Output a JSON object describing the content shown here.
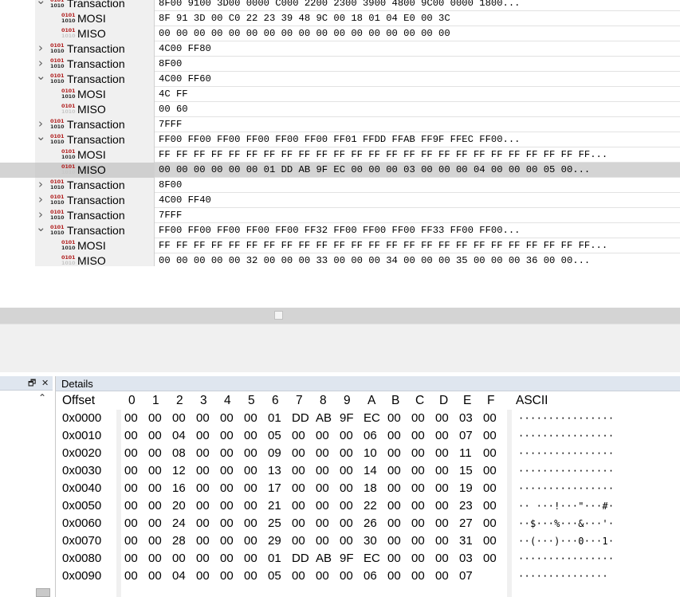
{
  "tree": {
    "rows": [
      {
        "label": "Transaction",
        "value": "8F00 9100 3D00 0000 C000 2200 2300 3900 4800 9C00 0000 1800...",
        "kind": "transaction",
        "expanded": true
      },
      {
        "label": "MOSI",
        "value": "8F 91 3D 00 C0 22 23 39 48 9C 00 18 01 04 E0 00 3C",
        "kind": "mosi"
      },
      {
        "label": "MISO",
        "value": "00 00 00 00 00 00 00 00 00 00 00 00 00 00 00 00 00",
        "kind": "miso"
      },
      {
        "label": "Transaction",
        "value": "4C00 FF80",
        "kind": "transaction",
        "expanded": false
      },
      {
        "label": "Transaction",
        "value": "8F00",
        "kind": "transaction",
        "expanded": false
      },
      {
        "label": "Transaction",
        "value": "4C00 FF60",
        "kind": "transaction",
        "expanded": true
      },
      {
        "label": "MOSI",
        "value": "4C FF",
        "kind": "mosi"
      },
      {
        "label": "MISO",
        "value": "00 60",
        "kind": "miso"
      },
      {
        "label": "Transaction",
        "value": "7FFF",
        "kind": "transaction",
        "expanded": false
      },
      {
        "label": "Transaction",
        "value": "FF00 FF00 FF00 FF00 FF00 FF00 FF01 FFDD FFAB FF9F FFEC FF00...",
        "kind": "transaction",
        "expanded": true
      },
      {
        "label": "MOSI",
        "value": "FF FF FF FF FF FF FF FF FF FF FF FF FF FF FF FF FF FF FF FF FF FF FF FF FF...",
        "kind": "mosi"
      },
      {
        "label": "MISO",
        "value": "00 00 00 00 00 00 01 DD AB 9F EC 00 00 00 03 00 00 00 04 00 00 00 05 00...",
        "kind": "miso",
        "selected": true
      },
      {
        "label": "Transaction",
        "value": "8F00",
        "kind": "transaction",
        "expanded": false
      },
      {
        "label": "Transaction",
        "value": "4C00 FF40",
        "kind": "transaction",
        "expanded": false
      },
      {
        "label": "Transaction",
        "value": "7FFF",
        "kind": "transaction",
        "expanded": false
      },
      {
        "label": "Transaction",
        "value": "FF00 FF00 FF00 FF00 FF00 FF32 FF00 FF00 FF00 FF33 FF00 FF00...",
        "kind": "transaction",
        "expanded": true
      },
      {
        "label": "MOSI",
        "value": "FF FF FF FF FF FF FF FF FF FF FF FF FF FF FF FF FF FF FF FF FF FF FF FF FF...",
        "kind": "mosi"
      },
      {
        "label": "MISO",
        "value": "00 00 00 00 00 32 00 00 00 33 00 00 00 34 00 00 00 35 00 00 00 36 00 00...",
        "kind": "miso"
      }
    ],
    "bits_top": "0101",
    "bits_bottom": "1010"
  },
  "details": {
    "title": "Details",
    "offset_header": "Offset",
    "ascii_header": "ASCII",
    "columns": [
      "0",
      "1",
      "2",
      "3",
      "4",
      "5",
      "6",
      "7",
      "8",
      "9",
      "A",
      "B",
      "C",
      "D",
      "E",
      "F"
    ],
    "rows": [
      {
        "offset": "0x0000",
        "bytes": [
          "00",
          "00",
          "00",
          "00",
          "00",
          "00",
          "01",
          "DD",
          "AB",
          "9F",
          "EC",
          "00",
          "00",
          "00",
          "03",
          "00"
        ],
        "ascii": "················"
      },
      {
        "offset": "0x0010",
        "bytes": [
          "00",
          "00",
          "04",
          "00",
          "00",
          "00",
          "05",
          "00",
          "00",
          "00",
          "06",
          "00",
          "00",
          "00",
          "07",
          "00"
        ],
        "ascii": "················"
      },
      {
        "offset": "0x0020",
        "bytes": [
          "00",
          "00",
          "08",
          "00",
          "00",
          "00",
          "09",
          "00",
          "00",
          "00",
          "10",
          "00",
          "00",
          "00",
          "11",
          "00"
        ],
        "ascii": "················"
      },
      {
        "offset": "0x0030",
        "bytes": [
          "00",
          "00",
          "12",
          "00",
          "00",
          "00",
          "13",
          "00",
          "00",
          "00",
          "14",
          "00",
          "00",
          "00",
          "15",
          "00"
        ],
        "ascii": "················"
      },
      {
        "offset": "0x0040",
        "bytes": [
          "00",
          "00",
          "16",
          "00",
          "00",
          "00",
          "17",
          "00",
          "00",
          "00",
          "18",
          "00",
          "00",
          "00",
          "19",
          "00"
        ],
        "ascii": "················"
      },
      {
        "offset": "0x0050",
        "bytes": [
          "00",
          "00",
          "20",
          "00",
          "00",
          "00",
          "21",
          "00",
          "00",
          "00",
          "22",
          "00",
          "00",
          "00",
          "23",
          "00"
        ],
        "ascii": "·· ···!···\"···#·"
      },
      {
        "offset": "0x0060",
        "bytes": [
          "00",
          "00",
          "24",
          "00",
          "00",
          "00",
          "25",
          "00",
          "00",
          "00",
          "26",
          "00",
          "00",
          "00",
          "27",
          "00"
        ],
        "ascii": "··$···%···&···'·"
      },
      {
        "offset": "0x0070",
        "bytes": [
          "00",
          "00",
          "28",
          "00",
          "00",
          "00",
          "29",
          "00",
          "00",
          "00",
          "30",
          "00",
          "00",
          "00",
          "31",
          "00"
        ],
        "ascii": "··(···)···0···1·"
      },
      {
        "offset": "0x0080",
        "bytes": [
          "00",
          "00",
          "00",
          "00",
          "00",
          "00",
          "01",
          "DD",
          "AB",
          "9F",
          "EC",
          "00",
          "00",
          "00",
          "03",
          "00"
        ],
        "ascii": "················"
      },
      {
        "offset": "0x0090",
        "bytes": [
          "00",
          "00",
          "04",
          "00",
          "00",
          "00",
          "05",
          "00",
          "00",
          "00",
          "06",
          "00",
          "00",
          "00",
          "07",
          ""
        ],
        "ascii": "···············"
      }
    ]
  },
  "icons": {
    "restore": "restore-window-icon",
    "close": "close-icon",
    "collapse": "chevron-up-icon",
    "expand_open": "chevron-down-icon",
    "expand_closed": "chevron-right-icon",
    "binary": "binary-data-icon"
  }
}
